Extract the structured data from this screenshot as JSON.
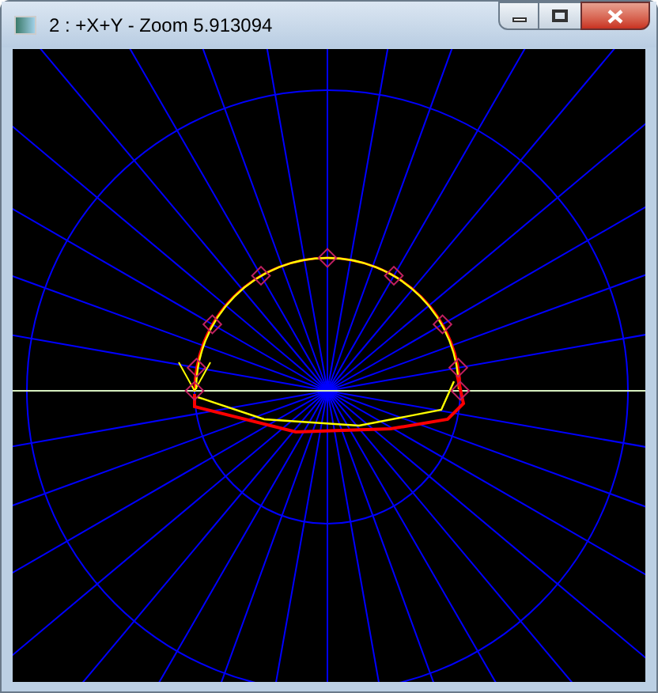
{
  "window": {
    "title": "2 : +X+Y - Zoom 5.913094"
  }
}
